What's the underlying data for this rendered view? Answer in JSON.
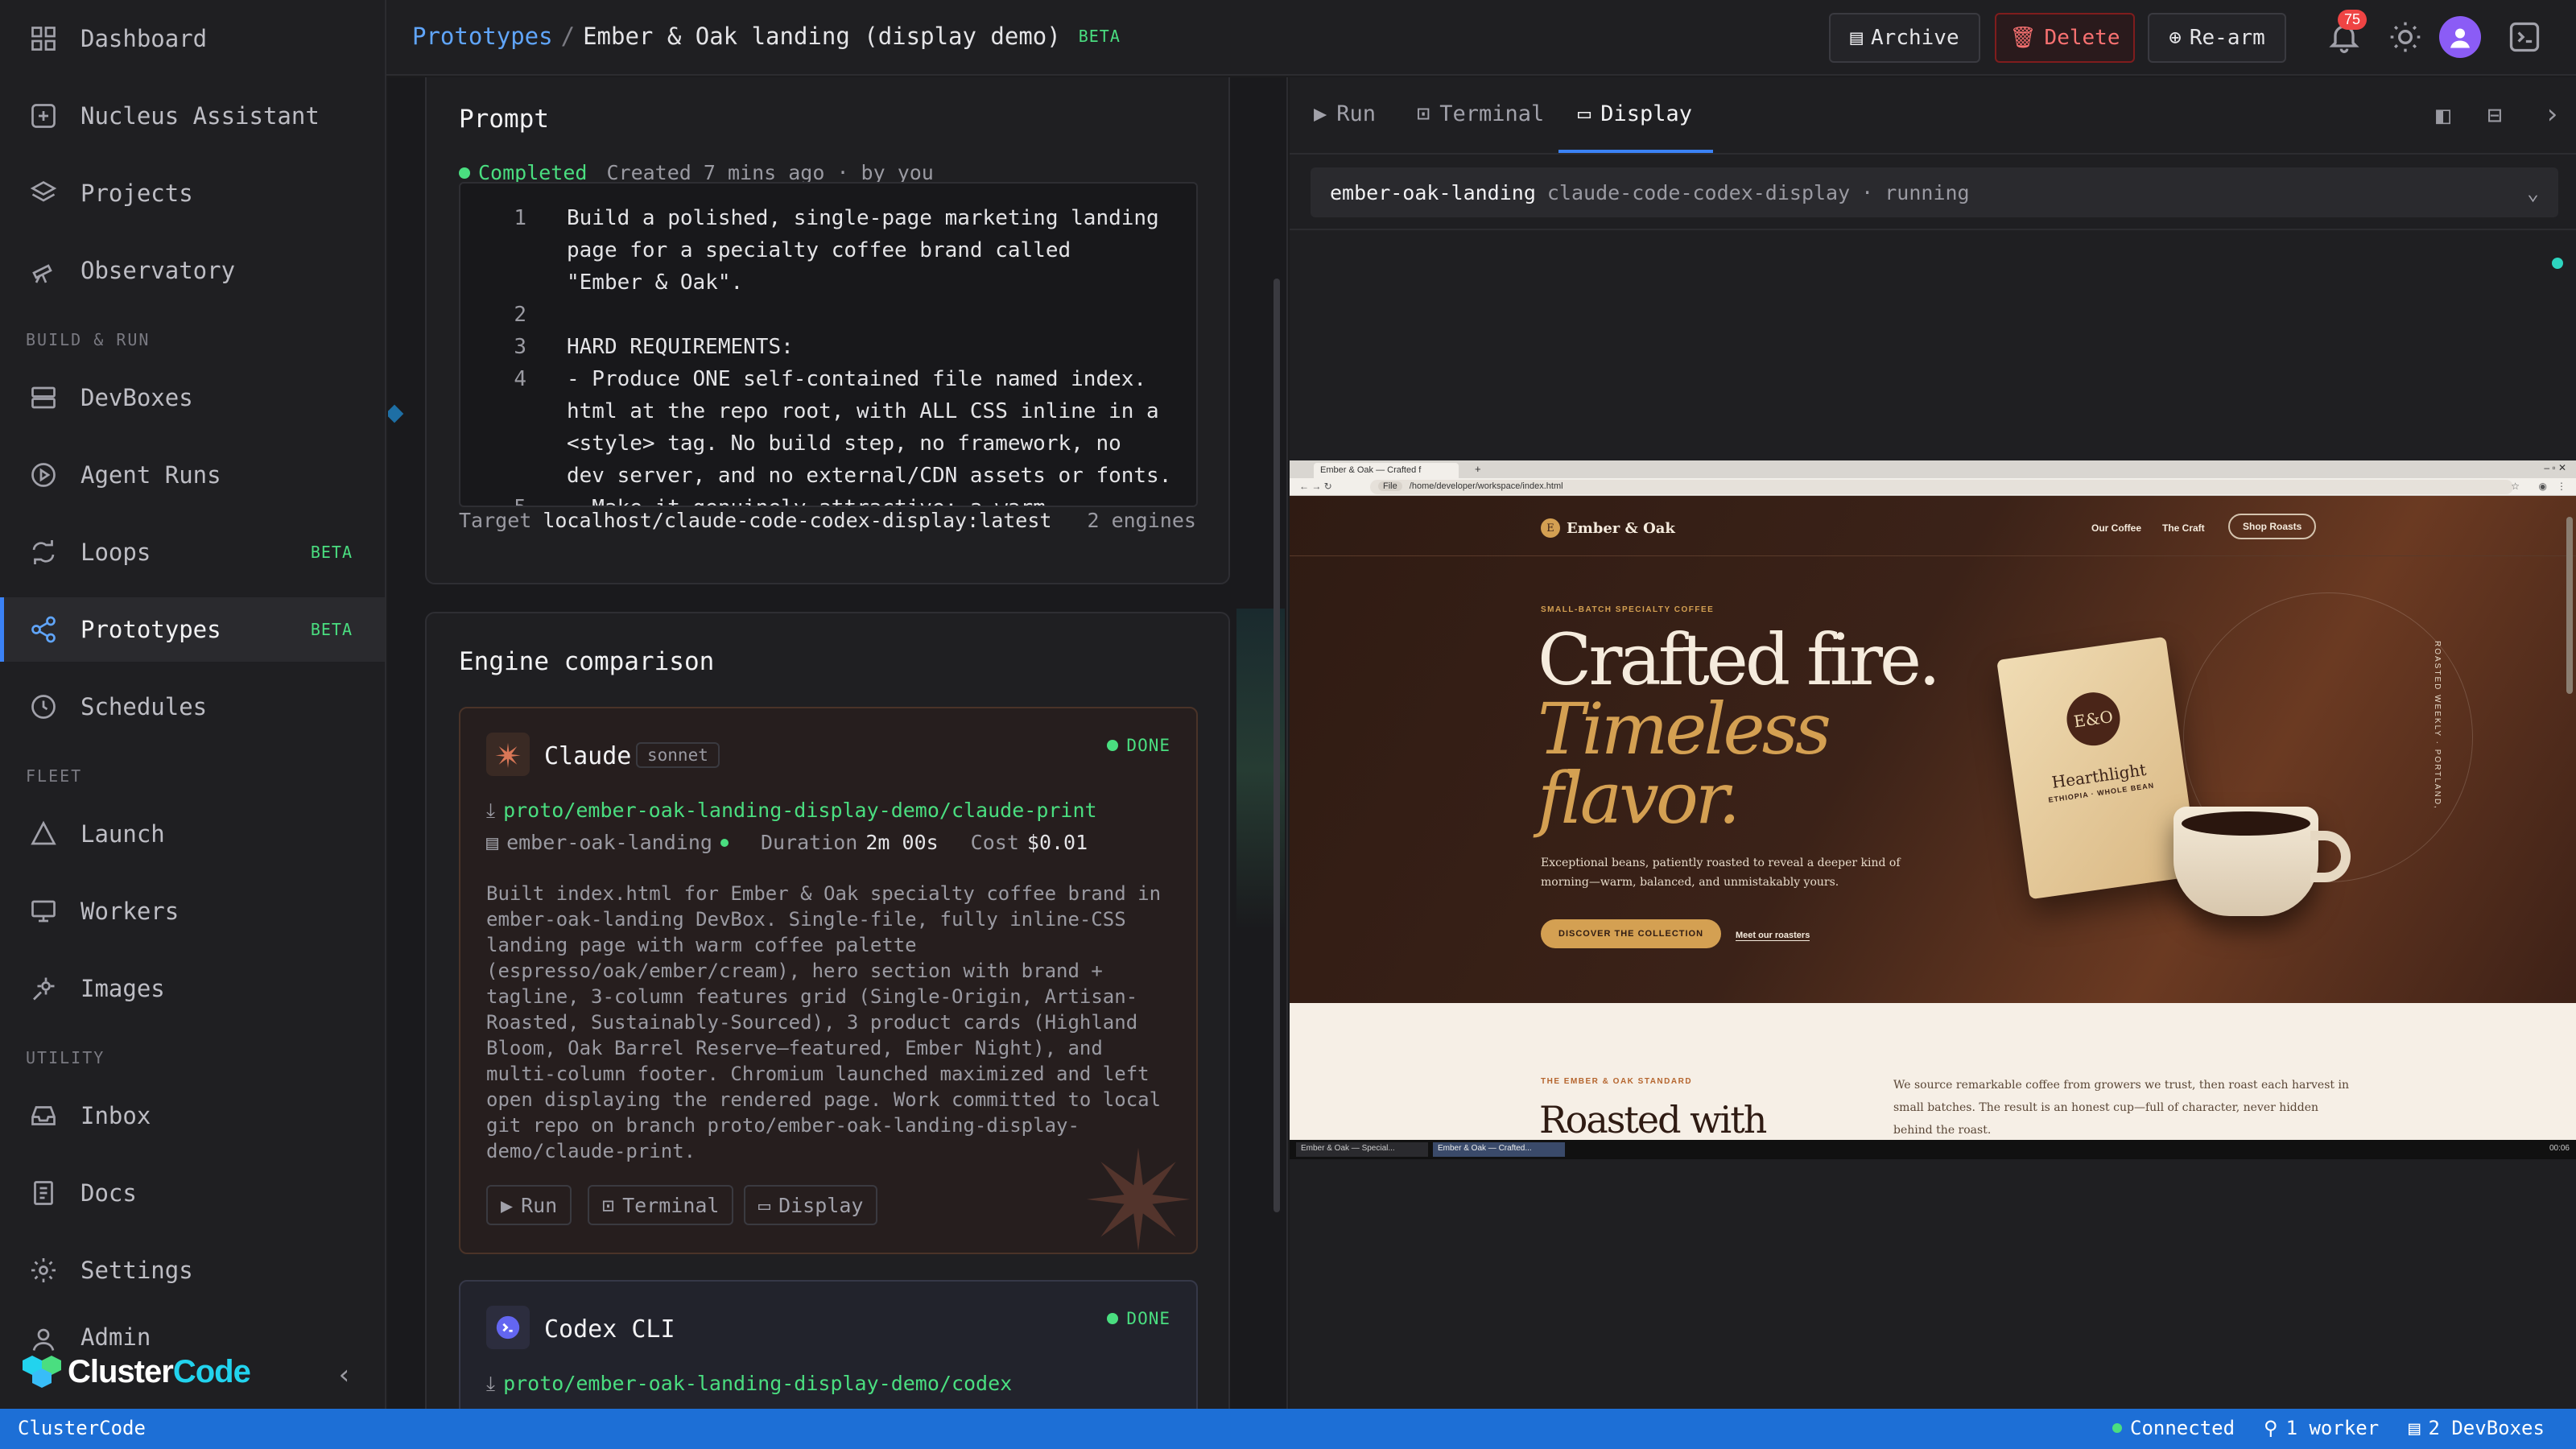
{
  "sidebar": {
    "items": [
      {
        "label": "Dashboard",
        "icon": "grid-icon"
      },
      {
        "label": "Nucleus Assistant",
        "icon": "assistant-icon"
      },
      {
        "label": "Projects",
        "icon": "layers-icon"
      },
      {
        "label": "Observatory",
        "icon": "telescope-icon"
      }
    ],
    "build_run_label": "BUILD & RUN",
    "build_run": [
      {
        "label": "DevBoxes",
        "icon": "server-icon"
      },
      {
        "label": "Agent Runs",
        "icon": "play-circle-icon"
      },
      {
        "label": "Loops",
        "icon": "loop-icon",
        "badge": "BETA"
      },
      {
        "label": "Prototypes",
        "icon": "share-icon",
        "badge": "BETA"
      },
      {
        "label": "Schedules",
        "icon": "clock-icon"
      }
    ],
    "fleet_label": "FLEET",
    "fleet": [
      {
        "label": "Launch",
        "icon": "triangle-icon"
      },
      {
        "label": "Workers",
        "icon": "monitor-icon"
      },
      {
        "label": "Images",
        "icon": "image-gear-icon"
      }
    ],
    "utility_label": "UTILITY",
    "utility": [
      {
        "label": "Inbox",
        "icon": "inbox-icon"
      },
      {
        "label": "Docs",
        "icon": "doc-icon"
      },
      {
        "label": "Settings",
        "icon": "gear-icon"
      },
      {
        "label": "Admin",
        "icon": "admin-icon"
      }
    ],
    "brand_a": "Cluster",
    "brand_b": "Code"
  },
  "header": {
    "crumb_parent": "Prototypes",
    "crumb_sep": "/",
    "crumb_current": "Ember & Oak landing (display demo)",
    "crumb_badge": "BETA",
    "archive": "Archive",
    "delete": "Delete",
    "rearm": "Re-arm",
    "notifications": "75"
  },
  "prompt": {
    "title": "Prompt",
    "status": "Completed",
    "meta": "Created 7 mins ago · by you",
    "lines": [
      {
        "n": "1",
        "t": "Build a polished, single-page marketing landing"
      },
      {
        "n": "",
        "t": "page for a specialty coffee brand called"
      },
      {
        "n": "",
        "t": "\"Ember & Oak\"."
      },
      {
        "n": "2",
        "t": ""
      },
      {
        "n": "3",
        "t": "HARD REQUIREMENTS:"
      },
      {
        "n": "4",
        "t": "- Produce ONE self-contained file named index."
      },
      {
        "n": "",
        "t": "html at the repo root, with ALL CSS inline in a"
      },
      {
        "n": "",
        "t": "<style> tag. No build step, no framework, no"
      },
      {
        "n": "",
        "t": "dev server, and no external/CDN assets or fonts."
      },
      {
        "n": "5",
        "t": "- Make it genuinely attractive: a warm"
      }
    ],
    "target_label": "Target",
    "target_value": "localhost/claude-code-codex-display:latest",
    "engines": "2 engines"
  },
  "comparison": {
    "title": "Engine comparison",
    "claude": {
      "name": "Claude",
      "model": "sonnet",
      "status": "DONE",
      "branch": "proto/ember-oak-landing-display-demo/claude-print",
      "devbox": "ember-oak-landing",
      "duration_label": "Duration",
      "duration": "2m 00s",
      "cost_label": "Cost",
      "cost": "$0.01",
      "summary": [
        "Built index.html for Ember & Oak specialty coffee brand in",
        "ember-oak-landing DevBox. Single-file, fully inline-CSS",
        "landing page with warm coffee palette",
        "(espresso/oak/ember/cream), hero section with brand +",
        "tagline, 3-column features grid (Single-Origin, Artisan-",
        "Roasted, Sustainably-Sourced), 3 product cards (Highland",
        "Bloom, Oak Barrel Reserve—featured, Ember Night), and",
        "multi-column footer. Chromium launched maximized and left",
        "open displaying the rendered page. Work committed to local",
        "git repo on branch proto/ember-oak-landing-display-",
        "demo/claude-print."
      ],
      "btn_run": "Run",
      "btn_terminal": "Terminal",
      "btn_display": "Display"
    },
    "codex": {
      "name": "Codex CLI",
      "status": "DONE",
      "branch": "proto/ember-oak-landing-display-demo/codex"
    }
  },
  "right": {
    "tab_run": "Run",
    "tab_terminal": "Terminal",
    "tab_display": "Display",
    "devbox_name": "ember-oak-landing",
    "devbox_image": "claude-code-codex-display",
    "devbox_sep": "·",
    "devbox_state": "running"
  },
  "browser": {
    "tab_title": "Ember & Oak — Crafted f",
    "url": "/home/developer/workspace/index.html",
    "url_prefix": "File",
    "site": {
      "logo_mark": "E",
      "brand": "Ember & Oak",
      "nav": [
        "Our Coffee",
        "The Craft"
      ],
      "nav_cta": "Shop Roasts",
      "eyebrow": "SMALL-BATCH SPECIALTY COFFEE",
      "h1a": "Crafted fire.",
      "h1b": "Timeless",
      "h1c": "flavor.",
      "lede1": "Exceptional beans, patiently roasted to reveal a deeper kind of",
      "lede2": "morning—warm, balanced, and unmistakably yours.",
      "cta_primary": "DISCOVER THE COLLECTION",
      "cta_secondary": "Meet our roasters",
      "bag_mark": "E&O",
      "bag_name": "Hearthlight",
      "bag_sub": "ETHIOPIA · WHOLE BEAN",
      "vertical": "ROASTED WEEKLY · PORTLAND, ORE",
      "sec_eyebrow": "THE EMBER & OAK STANDARD",
      "sec_title": "Roasted with",
      "sec_body1": "We source remarkable coffee from growers we trust, then roast each harvest in",
      "sec_body2": "small batches. The result is an honest cup—full of character, never hidden",
      "sec_body3": "behind the roast."
    },
    "task1": "Ember & Oak — Special...",
    "task2": "Ember & Oak — Crafted...",
    "clock": "00:06"
  },
  "status": {
    "app": "ClusterCode",
    "connected": "Connected",
    "workers": "1 worker",
    "devboxes": "2 DevBoxes"
  },
  "colors": {
    "accent": "#3b82f6",
    "success": "#4ade80",
    "danger": "#ef4444",
    "statusbar": "#1d6fd6"
  }
}
